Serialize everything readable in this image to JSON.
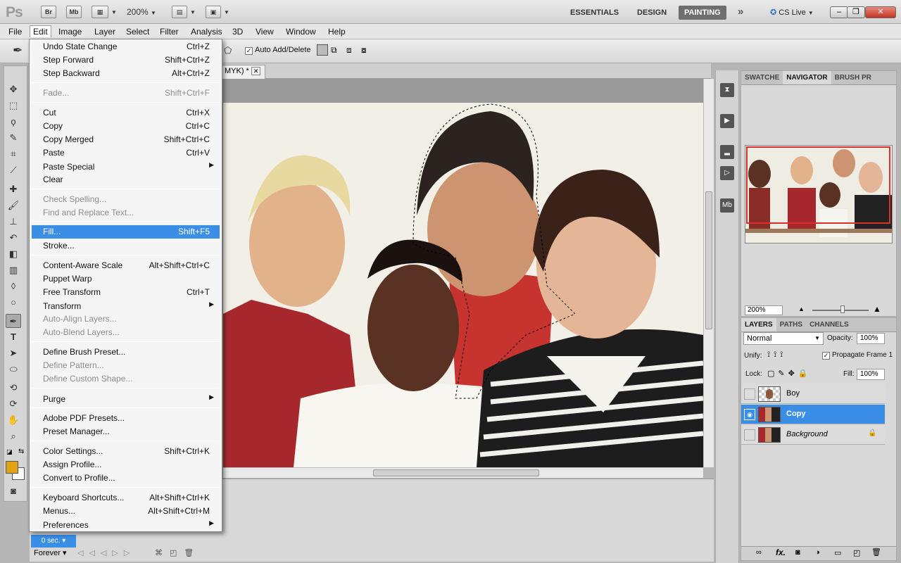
{
  "app": {
    "logo": "Ps",
    "buttons": [
      "Br",
      "Mb"
    ],
    "zoom": "200%",
    "workspaces": [
      "ESSENTIALS",
      "DESIGN",
      "PAINTING"
    ],
    "active_workspace": "PAINTING",
    "cs_live": "CS Live"
  },
  "menubar": [
    "File",
    "Edit",
    "Image",
    "Layer",
    "Select",
    "Filter",
    "Analysis",
    "3D",
    "View",
    "Window",
    "Help"
  ],
  "options": {
    "auto_add_delete": "Auto Add/Delete"
  },
  "document": {
    "tab_title": "MYK) *"
  },
  "edit_menu": [
    {
      "label": "Undo State Change",
      "shortcut": "Ctrl+Z"
    },
    {
      "label": "Step Forward",
      "shortcut": "Shift+Ctrl+Z"
    },
    {
      "label": "Step Backward",
      "shortcut": "Alt+Ctrl+Z"
    },
    {
      "label": "Fade...",
      "shortcut": "Shift+Ctrl+F"
    },
    {
      "label": "Cut",
      "shortcut": "Ctrl+X"
    },
    {
      "label": "Copy",
      "shortcut": "Ctrl+C"
    },
    {
      "label": "Copy Merged",
      "shortcut": "Shift+Ctrl+C"
    },
    {
      "label": "Paste",
      "shortcut": "Ctrl+V"
    },
    {
      "label": "Paste Special",
      "shortcut": ""
    },
    {
      "label": "Clear",
      "shortcut": ""
    },
    {
      "label": "Check Spelling...",
      "shortcut": ""
    },
    {
      "label": "Find and Replace Text...",
      "shortcut": ""
    },
    {
      "label": "Fill...",
      "shortcut": "Shift+F5"
    },
    {
      "label": "Stroke...",
      "shortcut": ""
    },
    {
      "label": "Content-Aware Scale",
      "shortcut": "Alt+Shift+Ctrl+C"
    },
    {
      "label": "Puppet Warp",
      "shortcut": ""
    },
    {
      "label": "Free Transform",
      "shortcut": "Ctrl+T"
    },
    {
      "label": "Transform",
      "shortcut": ""
    },
    {
      "label": "Auto-Align Layers...",
      "shortcut": ""
    },
    {
      "label": "Auto-Blend Layers...",
      "shortcut": ""
    },
    {
      "label": "Define Brush Preset...",
      "shortcut": ""
    },
    {
      "label": "Define Pattern...",
      "shortcut": ""
    },
    {
      "label": "Define Custom Shape...",
      "shortcut": ""
    },
    {
      "label": "Purge",
      "shortcut": ""
    },
    {
      "label": "Adobe PDF Presets...",
      "shortcut": ""
    },
    {
      "label": "Preset Manager...",
      "shortcut": ""
    },
    {
      "label": "Color Settings...",
      "shortcut": "Shift+Ctrl+K"
    },
    {
      "label": "Assign Profile...",
      "shortcut": ""
    },
    {
      "label": "Convert to Profile...",
      "shortcut": ""
    },
    {
      "label": "Keyboard Shortcuts...",
      "shortcut": "Alt+Shift+Ctrl+K"
    },
    {
      "label": "Menus...",
      "shortcut": "Alt+Shift+Ctrl+M"
    },
    {
      "label": "Preferences",
      "shortcut": ""
    }
  ],
  "navigator": {
    "tabs": [
      "SWATCHE",
      "NAVIGATOR",
      "BRUSH PR"
    ],
    "zoom": "200%"
  },
  "layers": {
    "tabs": [
      "LAYERS",
      "PATHS",
      "CHANNELS"
    ],
    "blend_mode": "Normal",
    "opacity_label": "Opacity:",
    "opacity": "100%",
    "unify_label": "Unify:",
    "propagate": "Propagate Frame 1",
    "lock_label": "Lock:",
    "fill_label": "Fill:",
    "fill": "100%",
    "items": [
      {
        "name": "Boy"
      },
      {
        "name": "Copy"
      },
      {
        "name": "Background"
      }
    ]
  },
  "animation": {
    "frame_delay": "0 sec.",
    "loop": "Forever"
  }
}
